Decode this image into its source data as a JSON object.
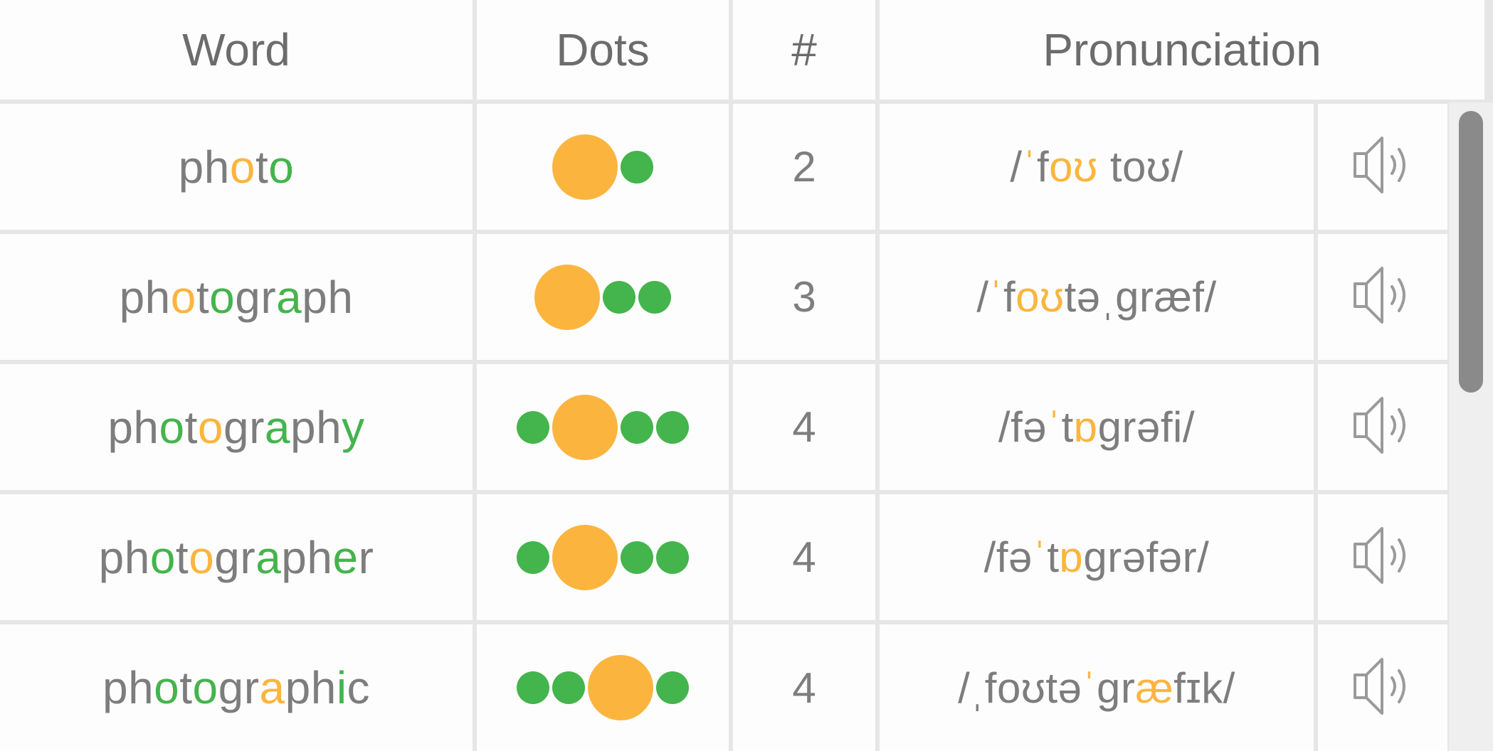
{
  "headers": {
    "word": "Word",
    "dots": "Dots",
    "count": "#",
    "pronunciation": "Pronunciation"
  },
  "colors": {
    "stressed": "#fbb53f",
    "vowel": "#44b44c",
    "text": "#7d7d7d",
    "grid": "#e6e6e6"
  },
  "speaker_icon": "speaker-icon",
  "rows": [
    {
      "word": [
        [
          "ph",
          "n"
        ],
        [
          "o",
          "o"
        ],
        [
          "t",
          "n"
        ],
        [
          "o",
          "g"
        ]
      ],
      "dots": [
        "big",
        "small"
      ],
      "count": "2",
      "pron": [
        [
          "/",
          "n"
        ],
        [
          "ˈ",
          "o"
        ],
        [
          "f",
          "n"
        ],
        [
          "oʊ",
          "o"
        ],
        [
          " to",
          "n"
        ],
        [
          "ʊ",
          "n"
        ],
        [
          "/",
          "n"
        ]
      ]
    },
    {
      "word": [
        [
          "ph",
          "n"
        ],
        [
          "o",
          "o"
        ],
        [
          "t",
          "n"
        ],
        [
          "o",
          "g"
        ],
        [
          "gr",
          "n"
        ],
        [
          "a",
          "g"
        ],
        [
          "ph",
          "n"
        ]
      ],
      "dots": [
        "big",
        "small",
        "small"
      ],
      "count": "3",
      "pron": [
        [
          "/",
          "n"
        ],
        [
          "ˈ",
          "o"
        ],
        [
          "f",
          "n"
        ],
        [
          "oʊ",
          "o"
        ],
        [
          "təˌgræf/",
          "n"
        ]
      ]
    },
    {
      "word": [
        [
          "ph",
          "n"
        ],
        [
          "o",
          "g"
        ],
        [
          "t",
          "n"
        ],
        [
          "o",
          "o"
        ],
        [
          "gr",
          "n"
        ],
        [
          "a",
          "g"
        ],
        [
          "ph",
          "n"
        ],
        [
          "y",
          "g"
        ]
      ],
      "dots": [
        "small",
        "big",
        "small",
        "small"
      ],
      "count": "4",
      "pron": [
        [
          "/fə",
          "n"
        ],
        [
          "ˈ",
          "o"
        ],
        [
          "t",
          "n"
        ],
        [
          "ɒ",
          "o"
        ],
        [
          "grəfi/",
          "n"
        ]
      ]
    },
    {
      "word": [
        [
          "ph",
          "n"
        ],
        [
          "o",
          "g"
        ],
        [
          "t",
          "n"
        ],
        [
          "o",
          "o"
        ],
        [
          "gr",
          "n"
        ],
        [
          "a",
          "g"
        ],
        [
          "ph",
          "n"
        ],
        [
          "e",
          "g"
        ],
        [
          "r",
          "n"
        ]
      ],
      "dots": [
        "small",
        "big",
        "small",
        "small"
      ],
      "count": "4",
      "pron": [
        [
          "/fə",
          "n"
        ],
        [
          "ˈ",
          "o"
        ],
        [
          "t",
          "n"
        ],
        [
          "ɒ",
          "o"
        ],
        [
          "grəfər/",
          "n"
        ]
      ]
    },
    {
      "word": [
        [
          "ph",
          "n"
        ],
        [
          "o",
          "g"
        ],
        [
          "t",
          "n"
        ],
        [
          "o",
          "g"
        ],
        [
          "gr",
          "n"
        ],
        [
          "a",
          "o"
        ],
        [
          "ph",
          "n"
        ],
        [
          "i",
          "g"
        ],
        [
          "c",
          "n"
        ]
      ],
      "dots": [
        "small",
        "small",
        "big",
        "small"
      ],
      "count": "4",
      "pron": [
        [
          "/ˌfoʊtə",
          "n"
        ],
        [
          "ˈ",
          "o"
        ],
        [
          "gr",
          "n"
        ],
        [
          "æ",
          "o"
        ],
        [
          "fɪk/",
          "n"
        ]
      ]
    }
  ]
}
